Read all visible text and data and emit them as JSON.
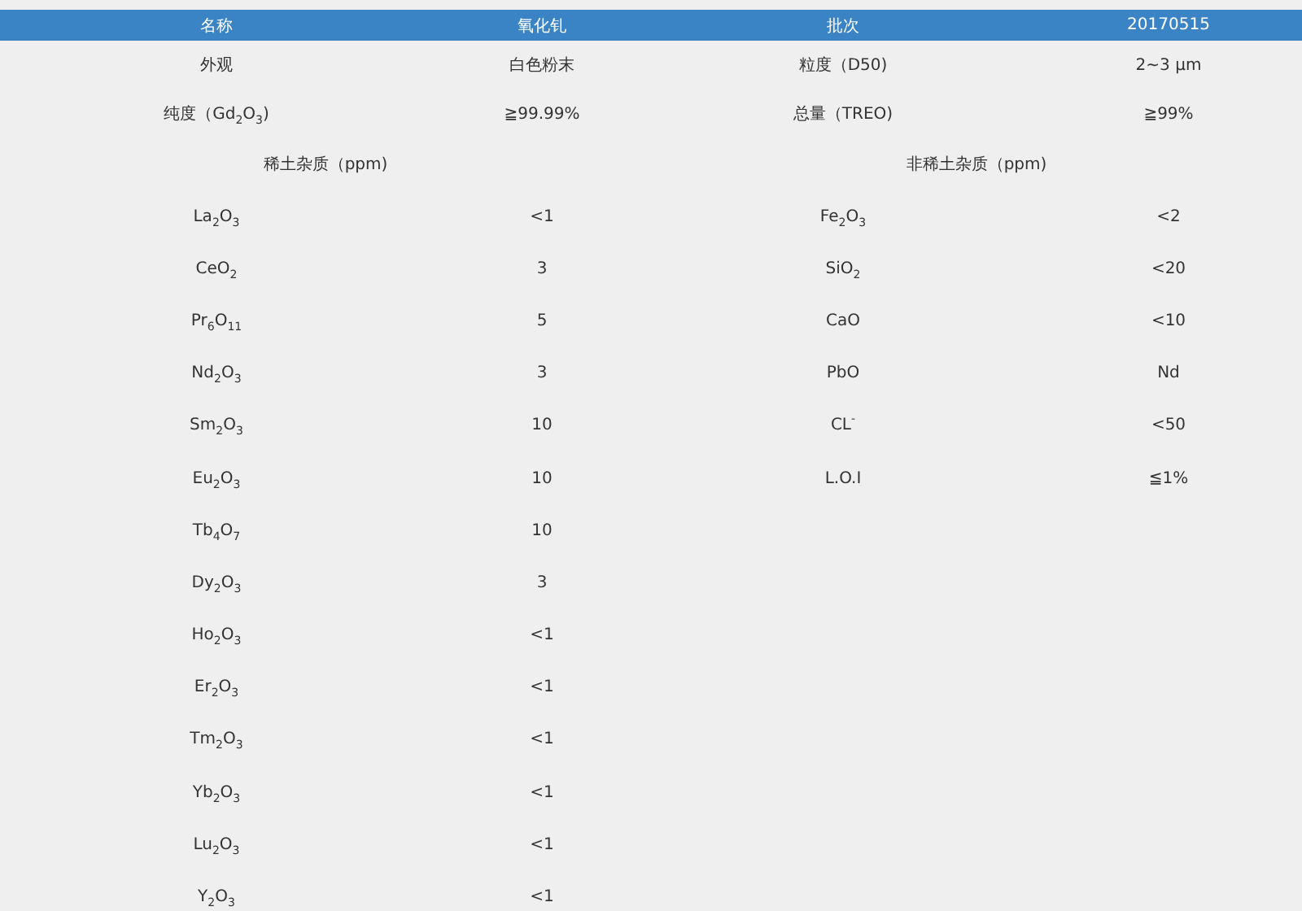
{
  "header": [
    "名称",
    "氧化钆",
    "批次",
    "20170515"
  ],
  "properties": [
    [
      "外观",
      "白色粉末",
      "粒度（D50)",
      "2~3 μm"
    ],
    [
      "纯度（Gd$_{2}$O$_{3}$)",
      "≧99.99%",
      "总量（TREO)",
      "≧99%"
    ]
  ],
  "sections": [
    "稀土杂质（ppm)",
    "非稀土杂质（ppm)"
  ],
  "rare_earth_impurities": [
    {
      "name": "La$_{2}$O$_{3}$",
      "value": "<1"
    },
    {
      "name": "CeO$_{2}$",
      "value": "3"
    },
    {
      "name": "Pr$_{6}$O$_{11}$",
      "value": "5"
    },
    {
      "name": "Nd$_{2}$O$_{3}$",
      "value": "3"
    },
    {
      "name": "Sm$_{2}$O$_{3}$",
      "value": "10"
    },
    {
      "name": "Eu$_{2}$O$_{3}$",
      "value": "10"
    },
    {
      "name": "Tb$_{4}$O$_{7}$",
      "value": "10"
    },
    {
      "name": "Dy$_{2}$O$_{3}$",
      "value": "3"
    },
    {
      "name": "Ho$_{2}$O$_{3}$",
      "value": "<1"
    },
    {
      "name": "Er$_{2}$O$_{3}$",
      "value": "<1"
    },
    {
      "name": "Tm$_{2}$O$_{3}$",
      "value": "<1"
    },
    {
      "name": "Yb$_{2}$O$_{3}$",
      "value": "<1"
    },
    {
      "name": "Lu$_{2}$O$_{3}$",
      "value": "<1"
    },
    {
      "name": "Y$_{2}$O$_{3}$",
      "value": "<1"
    }
  ],
  "non_rare_earth_impurities": [
    {
      "name": "Fe$_{2}$O$_{3}$",
      "value": "<2"
    },
    {
      "name": "SiO$_{2}$",
      "value": "<20"
    },
    {
      "name": "CaO",
      "value": "<10"
    },
    {
      "name": "PbO",
      "value": "Nd"
    },
    {
      "name": "CL$^{-}$",
      "value": "<50"
    },
    {
      "name": "L.O.I",
      "value": "≦1%"
    }
  ]
}
